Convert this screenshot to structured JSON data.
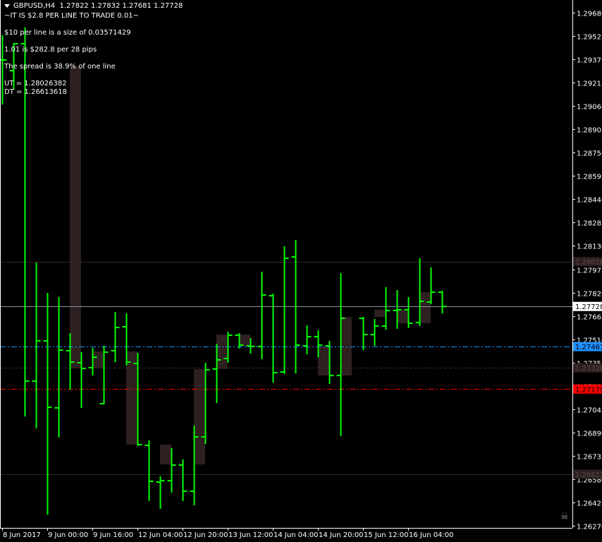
{
  "header": {
    "symbol": "GBPUSD,H4",
    "ohlc": "1.27822 1.27832 1.27681 1.27728"
  },
  "info_lines": [
    "~IT IS $2.8 PER LINE TO TRADE 0.01~",
    "$10 per line is a size of 0.03571429",
    "1.01 is $282.8 per 28 pips",
    "The spread is 38.9% of one line",
    "UT = 1.28026382",
    "DT = 1.26613618"
  ],
  "colors": {
    "background": "#000000",
    "bar": "#00ff00",
    "box": "#2e2020",
    "axis": "#ffffff",
    "bid_line": "#8a96a8",
    "blue_line": "#1e90ff",
    "red_line": "#ff0000",
    "level_line": "#3a2626"
  },
  "icons": {
    "skull": "skull-icon",
    "dropdown": "triangle-down-icon"
  },
  "chart_data": {
    "type": "ohlc",
    "timeframe": "H4",
    "ylim": [
      1.262,
      1.2975
    ],
    "y_ticks": [
      "1.29680",
      "1.29525",
      "1.29370",
      "1.29215",
      "1.29060",
      "1.28905",
      "1.28750",
      "1.28595",
      "1.28440",
      "1.28285",
      "1.28130",
      "1.27975",
      "1.27820",
      "1.27665",
      "1.27510",
      "1.27355",
      "1.27200",
      "1.27045",
      "1.26890",
      "1.26735",
      "1.26580",
      "1.26425",
      "1.26270"
    ],
    "x_labels": [
      {
        "bar": 0,
        "text": "8 Jun 2017"
      },
      {
        "bar": 4,
        "text": "9 Jun 00:00"
      },
      {
        "bar": 8,
        "text": "9 Jun 16:00"
      },
      {
        "bar": 12,
        "text": "12 Jun 04:00"
      },
      {
        "bar": 16,
        "text": "12 Jun 20:00"
      },
      {
        "bar": 20,
        "text": "13 Jun 12:00"
      },
      {
        "bar": 24,
        "text": "14 Jun 04:00"
      },
      {
        "bar": 28,
        "text": "14 Jun 20:00"
      },
      {
        "bar": 32,
        "text": "15 Jun 12:00"
      },
      {
        "bar": 36,
        "text": "16 Jun 04:00"
      }
    ],
    "bars": [
      [
        1.29366,
        1.2953,
        1.2907,
        1.29366
      ],
      [
        1.29295,
        1.29478,
        1.29169,
        1.29474
      ],
      [
        1.29474,
        1.29582,
        1.26997,
        1.27232
      ],
      [
        1.27232,
        1.2802,
        1.26918,
        1.27499
      ],
      [
        1.27499,
        1.27818,
        1.26345,
        1.27058
      ],
      [
        1.27054,
        1.2779,
        1.26857,
        1.27438
      ],
      [
        1.27434,
        1.27551,
        1.27175,
        1.27358
      ],
      [
        1.27354,
        1.27424,
        1.27054,
        1.27316
      ],
      [
        1.27321,
        1.27452,
        1.27269,
        1.27391
      ],
      [
        1.27082,
        1.27466,
        1.27077,
        1.27424
      ],
      [
        1.27434,
        1.27691,
        1.27358,
        1.27588
      ],
      [
        1.27593,
        1.27682,
        1.27335,
        1.27358
      ],
      [
        1.27349,
        1.27419,
        1.268,
        1.2681
      ],
      [
        1.26805,
        1.26838,
        1.26435,
        1.26566
      ],
      [
        1.26561,
        1.26599,
        1.26383,
        1.2657
      ],
      [
        1.2657,
        1.26786,
        1.26491,
        1.26674
      ],
      [
        1.26674,
        1.26711,
        1.26435,
        1.265
      ],
      [
        1.265,
        1.26936,
        1.26406,
        1.26861
      ],
      [
        1.26861,
        1.27354,
        1.26814,
        1.27307
      ],
      [
        1.27312,
        1.2748,
        1.27086,
        1.27373
      ],
      [
        1.27382,
        1.2756,
        1.27354,
        1.27537
      ],
      [
        1.27537,
        1.27551,
        1.27448,
        1.27471
      ],
      [
        1.27466,
        1.27518,
        1.27415,
        1.27462
      ],
      [
        1.27462,
        1.27959,
        1.27377,
        1.27804
      ],
      [
        1.27799,
        1.27813,
        1.27222,
        1.27288
      ],
      [
        1.27293,
        1.28128,
        1.27279,
        1.28048
      ],
      [
        1.28057,
        1.2817,
        1.27283,
        1.27471
      ],
      [
        1.27466,
        1.27602,
        1.2741,
        1.27527
      ],
      [
        1.27527,
        1.27569,
        1.27391,
        1.27471
      ],
      [
        1.27466,
        1.27499,
        1.27213,
        1.27269
      ],
      [
        1.27269,
        1.27949,
        1.26866,
        1.27649
      ],
      null,
      [
        1.27649,
        1.27658,
        1.27438,
        1.27541
      ],
      [
        1.27541,
        1.27644,
        1.27466,
        1.27598
      ],
      [
        1.27598,
        1.27856,
        1.27574,
        1.27701
      ],
      [
        1.27701,
        1.27837,
        1.27579,
        1.27706
      ],
      [
        1.27706,
        1.2779,
        1.27584,
        1.27616
      ],
      [
        1.27621,
        1.28048,
        1.27598,
        1.27762
      ],
      [
        1.27757,
        1.27987,
        1.27743,
        1.27823
      ],
      [
        1.27822,
        1.27832,
        1.27681,
        1.27728
      ]
    ],
    "boxes": [
      {
        "bar": 6,
        "top": 1.29319,
        "bottom": 1.27316
      },
      {
        "bar": 8,
        "top": 1.27429,
        "bottom": 1.27316
      },
      {
        "bar": 11,
        "top": 1.27429,
        "bottom": 1.2681
      },
      {
        "bar": 14,
        "top": 1.2681,
        "bottom": 1.26678
      },
      {
        "bar": 17,
        "top": 1.27312,
        "bottom": 1.26678
      },
      {
        "bar": 19,
        "top": 1.27541,
        "bottom": 1.27312
      },
      {
        "bar": 21,
        "top": 1.27541,
        "bottom": 1.27466
      },
      {
        "bar": 28,
        "top": 1.27462,
        "bottom": 1.27269
      },
      {
        "bar": 30,
        "top": 1.27658,
        "bottom": 1.27269
      },
      {
        "bar": 33,
        "top": 1.27706,
        "bottom": 1.27658
      },
      {
        "bar": 35,
        "top": 1.27706,
        "bottom": 1.27616
      },
      {
        "bar": 37,
        "top": 1.27823,
        "bottom": 1.27616
      }
    ],
    "levels": [
      {
        "name": "ut-line",
        "price": 1.28026,
        "label": "1.28026",
        "style": "solid",
        "color": "#3a2626",
        "label_bg": "#2e2020",
        "label_fg": "#5a4a4a"
      },
      {
        "name": "bid-line",
        "price": 1.27728,
        "label": "1.27728",
        "style": "solid",
        "color": "#8a96a8",
        "label_bg": "#ffffff",
        "label_fg": "#000000"
      },
      {
        "name": "blue-line",
        "price": 1.27461,
        "label": "1.27461",
        "style": "dashdot",
        "color": "#1e90ff",
        "label_bg": "#1e90ff",
        "label_fg": "#000000"
      },
      {
        "name": "mid-line",
        "price": 1.2732,
        "label": "1.27320",
        "style": "dash",
        "color": "#3a2626",
        "label_bg": "#2e2020",
        "label_fg": "#5a4a4a"
      },
      {
        "name": "red-line",
        "price": 1.27179,
        "label": "1.27179",
        "style": "dashdot",
        "color": "#ff0000",
        "label_bg": "#ff0000",
        "label_fg": "#000000"
      },
      {
        "name": "dt-line",
        "price": 1.26613,
        "label": "1.26613",
        "style": "solid",
        "color": "#3a2626",
        "label_bg": "#2e2020",
        "label_fg": "#5a4a4a"
      }
    ]
  }
}
